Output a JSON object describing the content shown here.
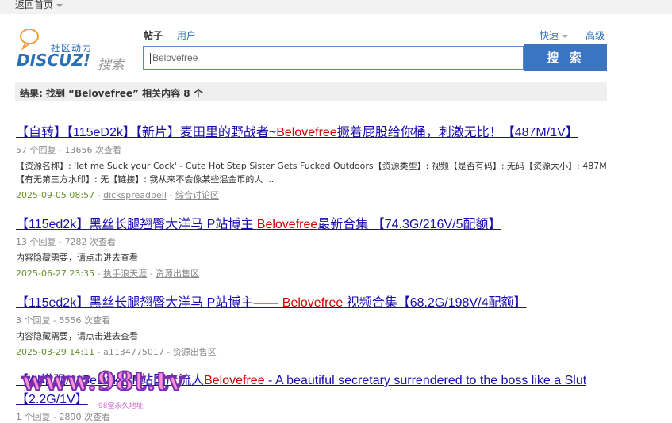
{
  "topbar": {
    "back_home": "返回首页"
  },
  "logo": {
    "cn_text": "社区动力",
    "brand": "DISCUZ!",
    "search_word": "搜索"
  },
  "tabs": {
    "post": "帖子",
    "user": "用户"
  },
  "quick": "快速",
  "advanced": "高级",
  "search": {
    "value": "Belovefree",
    "button": "搜 索"
  },
  "results_summary": "结果: 找到 “Belovefree” 相关内容 8 个",
  "results": [
    {
      "title_pre": "【自转】【115eD2k】【新片】麦田里的野战者~",
      "title_hl": "Belovefree",
      "title_post": "撅着屁股给你桶，刺激无比！【487M/1V】",
      "meta": "57 个回复 - 13656 次查看",
      "snippet": "【资源名称】: 'let me Suck your Cock' - Cute Hot Step Sister Gets Fucked Outdoors【资源类型】: 视频【是否有码】: 无码【资源大小】: 487M【有无第三方水印】: 无【链接】: 我从来不会像某些混金币的人 ...",
      "date": "2025-09-05 08:57",
      "author": "dickspreadbell",
      "forum": "综合讨论区"
    },
    {
      "title_pre": "【115ed2k】黑丝长腿翘臀大洋马 P站博主 ",
      "title_hl": "Belovefree",
      "title_post": "最新合集 【74.3G/216V/5配额】",
      "meta": "13 个回复 - 7282 次查看",
      "snippet": "内容隐藏需要，请点击进去查看",
      "date": "2025-06-27 23:35",
      "author": "执手浪天涯",
      "forum": "资源出售区"
    },
    {
      "title_pre": "【115ed2k】黑丝长腿翘臀大洋马 P站博主—— ",
      "title_hl": "Belovefree",
      "title_post": " 视频合集【68.2G/198V/4配额】",
      "meta": "3 个回复 - 5556 次查看",
      "snippet": "内容隐藏需要，请点击进去查看",
      "date": "2025-03-29 14:11",
      "author": "a1134775017",
      "forum": "资源出售区"
    },
    {
      "title_pre": "【AI增强/115eD2k】P站国产流人",
      "title_hl": "Belovefree",
      "title_post": " - A beautiful secretary surrendered to the boss like a Slut",
      "title_line2": "【2.2G/1V】",
      "meta": "1 个回复 - 2890 次查看"
    }
  ],
  "watermark": {
    "text": "www.98t.tv",
    "sub": "98堂永久地址"
  },
  "colors": {
    "link": "#1a0dab",
    "highlight": "#d40000",
    "date": "#6a8f2a",
    "button": "#3c74c4"
  }
}
